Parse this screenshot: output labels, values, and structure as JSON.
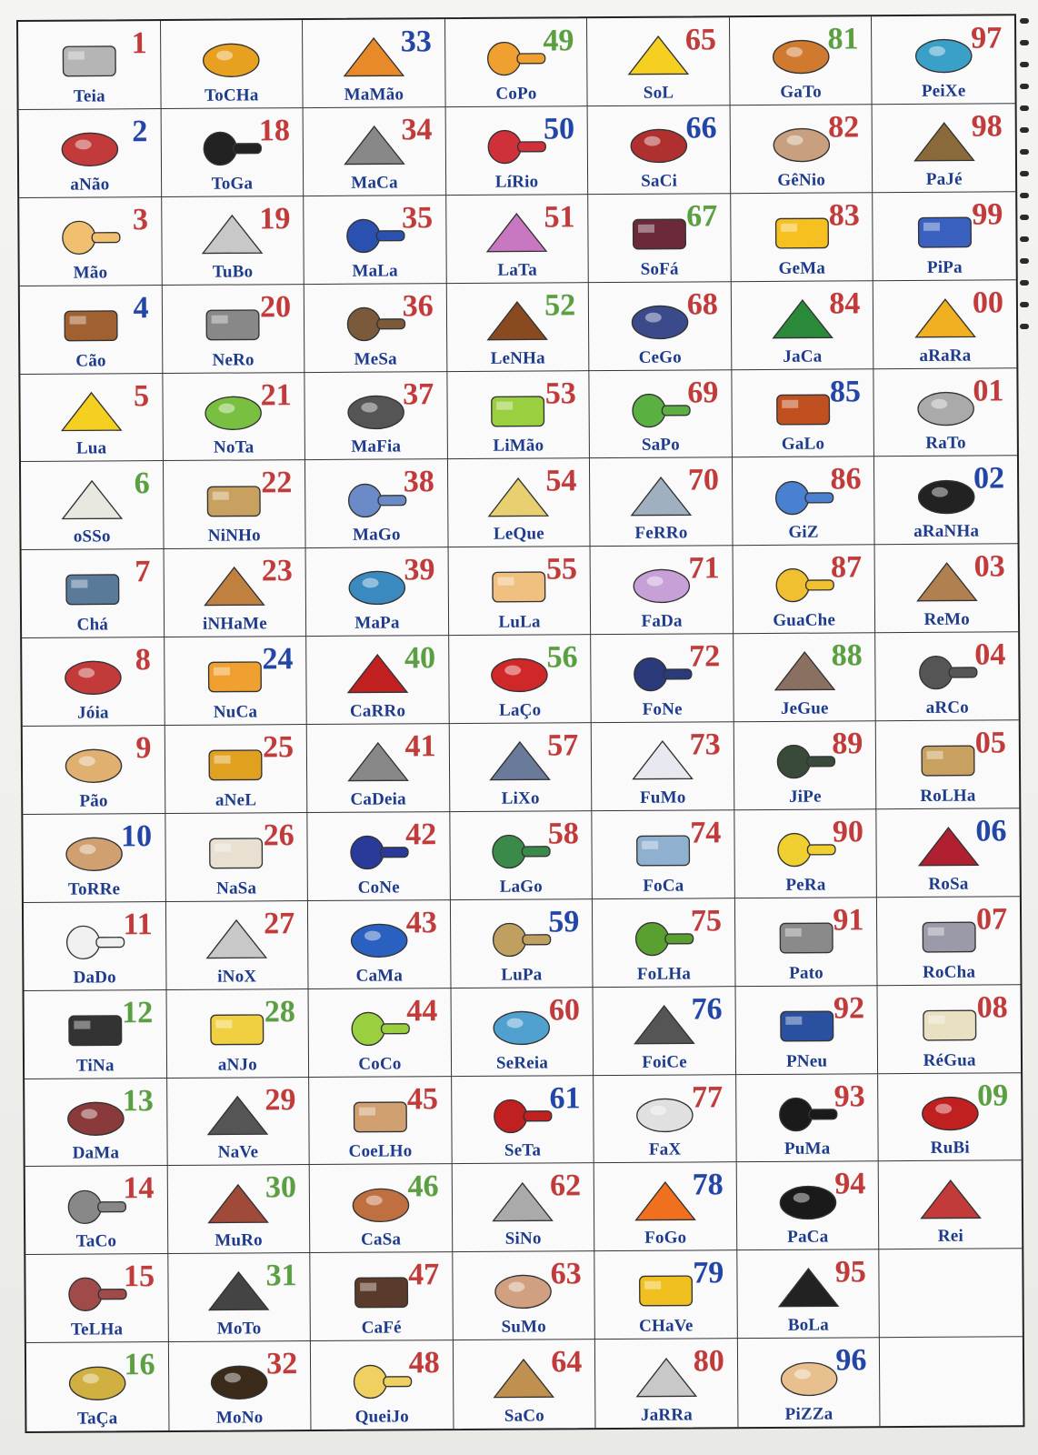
{
  "rows": [
    [
      {
        "word": "Teia",
        "num": "1",
        "icon": "spider-web",
        "tint": "#b5b5b5",
        "nc": "c-red"
      },
      {
        "word": "ToCHa",
        "num": "",
        "icon": "torch",
        "tint": "#e8a020",
        "nc": "c-red"
      },
      {
        "word": "MaMão",
        "num": "33",
        "icon": "papaya",
        "tint": "#e88a2a",
        "nc": "c-blue"
      },
      {
        "word": "CoPo",
        "num": "49",
        "icon": "glass",
        "tint": "#f0a030",
        "nc": "c-green"
      },
      {
        "word": "SoL",
        "num": "65",
        "icon": "sun",
        "tint": "#f5d020",
        "nc": "c-red"
      },
      {
        "word": "GaTo",
        "num": "81",
        "icon": "cat",
        "tint": "#d07a30",
        "nc": "c-green"
      },
      {
        "word": "PeiXe",
        "num": "97",
        "icon": "fish",
        "tint": "#3aa0c8",
        "nc": "c-red"
      }
    ],
    [
      {
        "word": "aNão",
        "num": "2",
        "icon": "dwarf",
        "tint": "#c23a3a",
        "nc": "c-blue"
      },
      {
        "word": "ToGa",
        "num": "18",
        "icon": "gown",
        "tint": "#222222",
        "nc": "c-red"
      },
      {
        "word": "MaCa",
        "num": "34",
        "icon": "stretcher",
        "tint": "#888888",
        "nc": "c-red"
      },
      {
        "word": "LíRio",
        "num": "50",
        "icon": "lily",
        "tint": "#d0303a",
        "nc": "c-blue"
      },
      {
        "word": "SaCi",
        "num": "66",
        "icon": "saci",
        "tint": "#b03030",
        "nc": "c-blue"
      },
      {
        "word": "GêNio",
        "num": "82",
        "icon": "genius",
        "tint": "#c8a080",
        "nc": "c-red"
      },
      {
        "word": "PaJé",
        "num": "98",
        "icon": "shaman",
        "tint": "#8a6a3a",
        "nc": "c-red"
      }
    ],
    [
      {
        "word": "Mão",
        "num": "3",
        "icon": "hand",
        "tint": "#f0c070",
        "nc": "c-red"
      },
      {
        "word": "TuBo",
        "num": "19",
        "icon": "tube",
        "tint": "#c8c8c8",
        "nc": "c-red"
      },
      {
        "word": "MaLa",
        "num": "35",
        "icon": "suitcase",
        "tint": "#2a50b0",
        "nc": "c-red"
      },
      {
        "word": "LaTa",
        "num": "51",
        "icon": "can",
        "tint": "#c878c0",
        "nc": "c-red"
      },
      {
        "word": "SoFá",
        "num": "67",
        "icon": "sofa",
        "tint": "#6a2a3a",
        "nc": "c-green"
      },
      {
        "word": "GeMa",
        "num": "83",
        "icon": "egg",
        "tint": "#f5c020",
        "nc": "c-red"
      },
      {
        "word": "PiPa",
        "num": "99",
        "icon": "kite",
        "tint": "#3a60c0",
        "nc": "c-red"
      }
    ],
    [
      {
        "word": "Cão",
        "num": "4",
        "icon": "dog",
        "tint": "#a06030",
        "nc": "c-blue"
      },
      {
        "word": "NeRo",
        "num": "20",
        "icon": "nero",
        "tint": "#888888",
        "nc": "c-red"
      },
      {
        "word": "MeSa",
        "num": "36",
        "icon": "table",
        "tint": "#7a5a3a",
        "nc": "c-red"
      },
      {
        "word": "LeNHa",
        "num": "52",
        "icon": "firewood",
        "tint": "#8a4a20",
        "nc": "c-green"
      },
      {
        "word": "CeGo",
        "num": "68",
        "icon": "blind",
        "tint": "#3a4a8a",
        "nc": "c-red"
      },
      {
        "word": "JaCa",
        "num": "84",
        "icon": "jackfruit",
        "tint": "#2a8a3a",
        "nc": "c-red"
      },
      {
        "word": "aRaRa",
        "num": "00",
        "icon": "macaw",
        "tint": "#f0b020",
        "nc": "c-red"
      }
    ],
    [
      {
        "word": "Lua",
        "num": "5",
        "icon": "moon",
        "tint": "#f5d020",
        "nc": "c-red"
      },
      {
        "word": "NoTa",
        "num": "21",
        "icon": "banknote",
        "tint": "#7ac040",
        "nc": "c-red"
      },
      {
        "word": "MaFia",
        "num": "37",
        "icon": "mafia",
        "tint": "#555555",
        "nc": "c-red"
      },
      {
        "word": "LiMão",
        "num": "53",
        "icon": "lemon",
        "tint": "#9ad040",
        "nc": "c-red"
      },
      {
        "word": "SaPo",
        "num": "69",
        "icon": "frog",
        "tint": "#5ab040",
        "nc": "c-red"
      },
      {
        "word": "GaLo",
        "num": "85",
        "icon": "rooster",
        "tint": "#c05020",
        "nc": "c-blue"
      },
      {
        "word": "RaTo",
        "num": "01",
        "icon": "rat",
        "tint": "#aaaaaa",
        "nc": "c-red"
      }
    ],
    [
      {
        "word": "oSSo",
        "num": "6",
        "icon": "bone",
        "tint": "#e8e8e0",
        "nc": "c-green"
      },
      {
        "word": "NiNHo",
        "num": "22",
        "icon": "nest",
        "tint": "#c8a060",
        "nc": "c-red"
      },
      {
        "word": "MaGo",
        "num": "38",
        "icon": "wizard",
        "tint": "#6a8ac8",
        "nc": "c-red"
      },
      {
        "word": "LeQue",
        "num": "54",
        "icon": "fan",
        "tint": "#e8d070",
        "nc": "c-red"
      },
      {
        "word": "FeRRo",
        "num": "70",
        "icon": "iron",
        "tint": "#a0b0c0",
        "nc": "c-red"
      },
      {
        "word": "GiZ",
        "num": "86",
        "icon": "chalk",
        "tint": "#4a80d0",
        "nc": "c-red"
      },
      {
        "word": "aRaNHa",
        "num": "02",
        "icon": "spider",
        "tint": "#222222",
        "nc": "c-blue"
      }
    ],
    [
      {
        "word": "Chá",
        "num": "7",
        "icon": "tea",
        "tint": "#5a7a9a",
        "nc": "c-red"
      },
      {
        "word": "iNHaMe",
        "num": "23",
        "icon": "yam",
        "tint": "#c08040",
        "nc": "c-red"
      },
      {
        "word": "MaPa",
        "num": "39",
        "icon": "map",
        "tint": "#3a8ac0",
        "nc": "c-red"
      },
      {
        "word": "LuLa",
        "num": "55",
        "icon": "octopus",
        "tint": "#f0c080",
        "nc": "c-red"
      },
      {
        "word": "FaDa",
        "num": "71",
        "icon": "fairy",
        "tint": "#c8a0d8",
        "nc": "c-red"
      },
      {
        "word": "GuaChe",
        "num": "87",
        "icon": "palette",
        "tint": "#f0c030",
        "nc": "c-red"
      },
      {
        "word": "ReMo",
        "num": "03",
        "icon": "oar",
        "tint": "#b08050",
        "nc": "c-red"
      }
    ],
    [
      {
        "word": "Jóia",
        "num": "8",
        "icon": "jewel",
        "tint": "#c23a3a",
        "nc": "c-red"
      },
      {
        "word": "NuCa",
        "num": "24",
        "icon": "nape",
        "tint": "#f0a030",
        "nc": "c-blue"
      },
      {
        "word": "CaRRo",
        "num": "40",
        "icon": "car",
        "tint": "#c02020",
        "nc": "c-green"
      },
      {
        "word": "LaÇo",
        "num": "56",
        "icon": "bow",
        "tint": "#d02828",
        "nc": "c-green"
      },
      {
        "word": "FoNe",
        "num": "72",
        "icon": "phone",
        "tint": "#2a3a7a",
        "nc": "c-red"
      },
      {
        "word": "JeGue",
        "num": "88",
        "icon": "donkey",
        "tint": "#8a7060",
        "nc": "c-green"
      },
      {
        "word": "aRCo",
        "num": "04",
        "icon": "bow-arrow",
        "tint": "#555555",
        "nc": "c-red"
      }
    ],
    [
      {
        "word": "Pão",
        "num": "9",
        "icon": "bread",
        "tint": "#e0b070",
        "nc": "c-red"
      },
      {
        "word": "aNeL",
        "num": "25",
        "icon": "ring",
        "tint": "#e0a020",
        "nc": "c-red"
      },
      {
        "word": "CaDeia",
        "num": "41",
        "icon": "jail",
        "tint": "#888888",
        "nc": "c-red"
      },
      {
        "word": "LiXo",
        "num": "57",
        "icon": "trash",
        "tint": "#6a7a9a",
        "nc": "c-red"
      },
      {
        "word": "FuMo",
        "num": "73",
        "icon": "cigarette",
        "tint": "#e8e8f0",
        "nc": "c-red"
      },
      {
        "word": "JiPe",
        "num": "89",
        "icon": "jeep",
        "tint": "#3a4a3a",
        "nc": "c-red"
      },
      {
        "word": "RoLHa",
        "num": "05",
        "icon": "cork",
        "tint": "#c8a060",
        "nc": "c-red"
      }
    ],
    [
      {
        "word": "ToRRe",
        "num": "10",
        "icon": "tower",
        "tint": "#d0a070",
        "nc": "c-blue"
      },
      {
        "word": "NaSa",
        "num": "26",
        "icon": "rocket",
        "tint": "#e8e0d0",
        "nc": "c-red"
      },
      {
        "word": "CoNe",
        "num": "42",
        "icon": "cone",
        "tint": "#2a3a9a",
        "nc": "c-red"
      },
      {
        "word": "LaGo",
        "num": "58",
        "icon": "lake",
        "tint": "#3a8a4a",
        "nc": "c-red"
      },
      {
        "word": "FoCa",
        "num": "74",
        "icon": "seal",
        "tint": "#90b0d0",
        "nc": "c-red"
      },
      {
        "word": "PeRa",
        "num": "90",
        "icon": "pear",
        "tint": "#f0d030",
        "nc": "c-red"
      },
      {
        "word": "RoSa",
        "num": "06",
        "icon": "rose",
        "tint": "#b02030",
        "nc": "c-blue"
      }
    ],
    [
      {
        "word": "DaDo",
        "num": "11",
        "icon": "dice",
        "tint": "#f0f0f0",
        "nc": "c-red"
      },
      {
        "word": "iNoX",
        "num": "27",
        "icon": "pot",
        "tint": "#c8c8c8",
        "nc": "c-red"
      },
      {
        "word": "CaMa",
        "num": "43",
        "icon": "bed",
        "tint": "#2a60c0",
        "nc": "c-red"
      },
      {
        "word": "LuPa",
        "num": "59",
        "icon": "magnifier",
        "tint": "#c0a060",
        "nc": "c-blue"
      },
      {
        "word": "FoLHa",
        "num": "75",
        "icon": "leaf",
        "tint": "#5aa030",
        "nc": "c-red"
      },
      {
        "word": "Pato",
        "num": "91",
        "icon": "duck",
        "tint": "#8a8a8a",
        "nc": "c-red"
      },
      {
        "word": "RoCha",
        "num": "07",
        "icon": "rock",
        "tint": "#9a9aa8",
        "nc": "c-red"
      }
    ],
    [
      {
        "word": "TiNa",
        "num": "12",
        "icon": "vat",
        "tint": "#333333",
        "nc": "c-green"
      },
      {
        "word": "aNJo",
        "num": "28",
        "icon": "angel",
        "tint": "#f0d040",
        "nc": "c-green"
      },
      {
        "word": "CoCo",
        "num": "44",
        "icon": "coconut",
        "tint": "#9ad040",
        "nc": "c-red"
      },
      {
        "word": "SeReia",
        "num": "60",
        "icon": "mermaid",
        "tint": "#50a0d0",
        "nc": "c-red"
      },
      {
        "word": "FoiCe",
        "num": "76",
        "icon": "sickle",
        "tint": "#555555",
        "nc": "c-blue"
      },
      {
        "word": "PNeu",
        "num": "92",
        "icon": "tire",
        "tint": "#2a50a0",
        "nc": "c-red"
      },
      {
        "word": "RéGua",
        "num": "08",
        "icon": "ruler",
        "tint": "#e8e0c0",
        "nc": "c-red"
      }
    ],
    [
      {
        "word": "DaMa",
        "num": "13",
        "icon": "checkers",
        "tint": "#8a3a3a",
        "nc": "c-green"
      },
      {
        "word": "NaVe",
        "num": "29",
        "icon": "ufo",
        "tint": "#555555",
        "nc": "c-red"
      },
      {
        "word": "CoeLHo",
        "num": "45",
        "icon": "rabbit",
        "tint": "#d0a070",
        "nc": "c-red"
      },
      {
        "word": "SeTa",
        "num": "61",
        "icon": "arrow",
        "tint": "#c02020",
        "nc": "c-blue"
      },
      {
        "word": "FaX",
        "num": "77",
        "icon": "fax",
        "tint": "#e0e0e0",
        "nc": "c-red"
      },
      {
        "word": "PuMa",
        "num": "93",
        "icon": "puma",
        "tint": "#1a1a1a",
        "nc": "c-red"
      },
      {
        "word": "RuBi",
        "num": "09",
        "icon": "ruby",
        "tint": "#c02020",
        "nc": "c-green"
      }
    ],
    [
      {
        "word": "TaCo",
        "num": "14",
        "icon": "golf-club",
        "tint": "#888888",
        "nc": "c-red"
      },
      {
        "word": "MuRo",
        "num": "30",
        "icon": "wall",
        "tint": "#a04a3a",
        "nc": "c-green"
      },
      {
        "word": "CaSa",
        "num": "46",
        "icon": "house",
        "tint": "#c07040",
        "nc": "c-green"
      },
      {
        "word": "SiNo",
        "num": "62",
        "icon": "bell",
        "tint": "#aaaaaa",
        "nc": "c-red"
      },
      {
        "word": "FoGo",
        "num": "78",
        "icon": "fire",
        "tint": "#f07020",
        "nc": "c-blue"
      },
      {
        "word": "PaCa",
        "num": "94",
        "icon": "paca",
        "tint": "#1a1a1a",
        "nc": "c-red"
      },
      {
        "word": "Rei",
        "num": "",
        "icon": "king",
        "tint": "#c23a3a",
        "nc": "c-red"
      }
    ],
    [
      {
        "word": "TeLHa",
        "num": "15",
        "icon": "roof-tile",
        "tint": "#a04a4a",
        "nc": "c-red"
      },
      {
        "word": "MoTo",
        "num": "31",
        "icon": "motorcycle",
        "tint": "#444444",
        "nc": "c-green"
      },
      {
        "word": "CaFé",
        "num": "47",
        "icon": "coffee",
        "tint": "#5a3a2a",
        "nc": "c-red"
      },
      {
        "word": "SuMo",
        "num": "63",
        "icon": "sumo",
        "tint": "#d0a080",
        "nc": "c-red"
      },
      {
        "word": "CHaVe",
        "num": "79",
        "icon": "key",
        "tint": "#f0c020",
        "nc": "c-blue"
      },
      {
        "word": "BoLa",
        "num": "95",
        "icon": "ball",
        "tint": "#222222",
        "nc": "c-red"
      },
      {
        "word": "",
        "num": "",
        "icon": "",
        "tint": "",
        "nc": "c-red"
      }
    ],
    [
      {
        "word": "TaÇa",
        "num": "16",
        "icon": "trophy",
        "tint": "#d0b040",
        "nc": "c-green"
      },
      {
        "word": "MoNo",
        "num": "32",
        "icon": "monkey",
        "tint": "#3a2a1a",
        "nc": "c-red"
      },
      {
        "word": "QueiJo",
        "num": "48",
        "icon": "cheese",
        "tint": "#f0d060",
        "nc": "c-red"
      },
      {
        "word": "SaCo",
        "num": "64",
        "icon": "sack",
        "tint": "#c09050",
        "nc": "c-red"
      },
      {
        "word": "JaRRa",
        "num": "80",
        "icon": "jar",
        "tint": "#c8c8c8",
        "nc": "c-red"
      },
      {
        "word": "PiZZa",
        "num": "96",
        "icon": "pizza",
        "tint": "#e8c090",
        "nc": "c-blue"
      },
      {
        "word": "",
        "num": "",
        "icon": "",
        "tint": "",
        "nc": "c-red"
      }
    ]
  ]
}
